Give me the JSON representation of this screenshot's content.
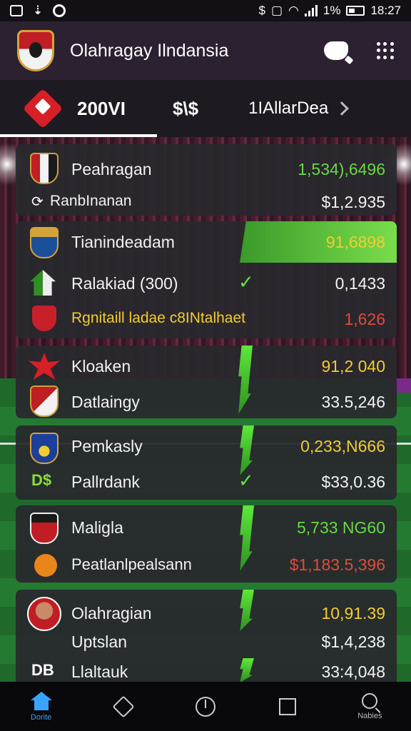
{
  "status_bar": {
    "battery_text": "1%",
    "time": "18:27"
  },
  "app": {
    "title": "Olahragay Ilndansia"
  },
  "tabs": [
    {
      "label": "200VI",
      "active": true
    },
    {
      "label": "$\\$"
    },
    {
      "label": "1IAllarDea"
    }
  ],
  "cards": [
    {
      "rows": [
        {
          "label": "Peahragan",
          "value": "1,534),6496",
          "value_color": "green"
        },
        {
          "label": "RanbInanan",
          "value": "$1,2.935",
          "value_color": "white"
        }
      ]
    },
    {
      "rows": [
        {
          "label": "Tianindeadam",
          "value": "91,6898",
          "value_color": "yellow",
          "highlighted": true
        },
        {
          "label": "Ralakiad (300)",
          "value": "0,1433",
          "value_color": "white"
        },
        {
          "label": "Rgnitaill ladae c8INtalhaet",
          "value": "1,626",
          "value_color": "red"
        }
      ]
    },
    {
      "rows": [
        {
          "label": "Kloaken",
          "value": "91,2 040",
          "value_color": "yellow"
        },
        {
          "label": "Datlaingy",
          "value": "33.5,246",
          "value_color": "white"
        }
      ]
    },
    {
      "rows": [
        {
          "label": "Pemkasly",
          "value": "0,233,N666",
          "value_color": "yellow"
        },
        {
          "label": "Pallrdank",
          "value": "$33,0.36",
          "value_color": "white",
          "badge": "D$"
        }
      ]
    },
    {
      "rows": [
        {
          "label": "Maligla",
          "value": "5,733 NG60",
          "value_color": "green"
        },
        {
          "label": "Peatlanlpealsann",
          "value": "$1,183.5,396",
          "value_color": "red"
        }
      ]
    },
    {
      "rows": [
        {
          "label": "Olahragian",
          "value": "10,91.39",
          "value_color": "yellow"
        },
        {
          "label": "Uptslan",
          "value": "$1,4,238",
          "value_color": "white"
        },
        {
          "label": "Llaltauk",
          "value": "33:4,048",
          "value_color": "white",
          "badge": "DB"
        }
      ]
    }
  ],
  "bottom_nav": [
    {
      "icon": "home-icon",
      "label": "Dorite",
      "active": true
    },
    {
      "icon": "diamond-icon"
    },
    {
      "icon": "power-icon"
    },
    {
      "icon": "square-icon"
    },
    {
      "icon": "search-icon",
      "label": "Nabies"
    }
  ],
  "colors": {
    "green": "#68d845",
    "yellow": "#f2cd2f",
    "red": "#e34a3a",
    "accent_blue": "#3aa3ff",
    "appbar": "#2c2130",
    "card": "#28282e"
  }
}
